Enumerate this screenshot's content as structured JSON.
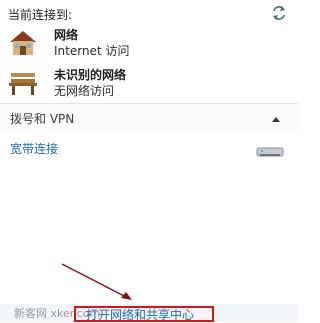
{
  "header": {
    "title": "当前连接到:"
  },
  "connections": [
    {
      "name": "网络",
      "status": "Internet 访问",
      "icon": "house-network-icon"
    },
    {
      "name": "未识别的网络",
      "status": "无网络访问",
      "icon": "bench-network-icon"
    }
  ],
  "dialup_section": {
    "title": "拨号和 VPN",
    "items": [
      {
        "label": "宽带连接",
        "icon": "modem-icon"
      }
    ]
  },
  "footer": {
    "link_label": "打开网络和共享中心",
    "watermark": "新客网 xker.com"
  },
  "colors": {
    "link": "#1a6fa8",
    "highlight_box": "#d01818",
    "annotation_arrow": "#8b0a0a"
  }
}
